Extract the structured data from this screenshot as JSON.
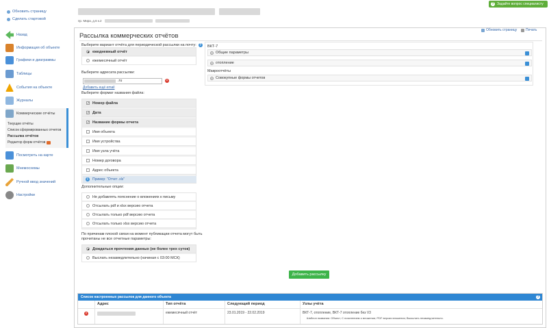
{
  "top": {
    "refresh_page": "Обновить страницу",
    "make_start": "Сделать стартовой",
    "question_btn": "Задайте вопрос специалисту",
    "address_prefix": "пр. Мира, д.6 к.2"
  },
  "sidebar": {
    "items": [
      {
        "label": "Назад",
        "icon": "back-arrow-icon",
        "color": "#5cb85c"
      },
      {
        "label": "Информация об объекте",
        "icon": "house-icon",
        "color": "#d9822b"
      },
      {
        "label": "Графики и диаграммы",
        "icon": "chart-icon",
        "color": "#4a90d9"
      },
      {
        "label": "Таблицы",
        "icon": "table-icon",
        "color": "#6b9bd1"
      },
      {
        "label": "События на объекте",
        "icon": "warning-icon",
        "color": "#f0a500"
      },
      {
        "label": "Журналы",
        "icon": "journal-icon",
        "color": "#8fb7e0"
      },
      {
        "label": "Коммерческие отчёты",
        "icon": "report-icon",
        "color": "#7fa6c9"
      }
    ],
    "sub_items": [
      {
        "label": "Текущие отчёты"
      },
      {
        "label": "Список сформированных отчетов"
      },
      {
        "label": "Рассылка отчётов"
      },
      {
        "label": "Редактор форм отчётов"
      }
    ],
    "items2": [
      {
        "label": "Посмотреть на карте",
        "icon": "map-icon",
        "color": "#4a90d9"
      },
      {
        "label": "Мнемосхемы",
        "icon": "mnemonic-icon",
        "color": "#6aa84f"
      },
      {
        "label": "Ручной ввод значений",
        "icon": "pencil-icon",
        "color": "#e8a33a"
      },
      {
        "label": "Настройки",
        "icon": "gear-icon",
        "color": "#888888"
      }
    ]
  },
  "main": {
    "title": "Рассылка коммерческих отчётов",
    "refresh_link": "Обновить страницу",
    "print_link": "Печать",
    "report_variant_label": "Выберите вариант отчёта для периодической рассылки на почту:",
    "variants": [
      {
        "label": "ежедневный отчёт",
        "selected": true
      },
      {
        "label": "ежемесячный отчёт",
        "selected": false
      }
    ],
    "address_label": "Выберите адресата рассылки:",
    "email_value": ".ru",
    "add_email": "Добавить ещё email",
    "file_name_label": "Выберите формат названия файла:",
    "file_options": [
      {
        "label": "Номер файла",
        "checked": true
      },
      {
        "label": "Дата",
        "checked": true
      },
      {
        "label": "Название формы отчета",
        "checked": true
      },
      {
        "label": "Имя объекта",
        "checked": false
      },
      {
        "label": "Имя устройства",
        "checked": false
      },
      {
        "label": "Имя узла учёта",
        "checked": false
      },
      {
        "label": "Номер договора",
        "checked": false
      },
      {
        "label": "Адрес объекта",
        "checked": false
      }
    ],
    "example": "Пример: \"Отчет .xls\"",
    "extra_label": "Дополнительные опции:",
    "extra_options": [
      {
        "label": "Не добавлять пояснение о вложениях к письму"
      },
      {
        "label": "Отсылать pdf и xlsx версию отчета"
      },
      {
        "label": "Отсылать только pdf версию отчета"
      },
      {
        "label": "Отсылать только xlsx версию отчета"
      }
    ],
    "bad_conn_label_1": "По причинам плохой связи на момент публикации отчета могут быть",
    "bad_conn_label_2": "прочитаны не все отчетные параметры:",
    "wait_options": [
      {
        "label": "Дождаться прочтения данных (не более трех суток)",
        "selected": true
      },
      {
        "label": "Выслать незамедлительно (начиная с 03:00 МСК)",
        "selected": false
      }
    ],
    "right": {
      "device_head": "ВКТ-7",
      "device_rows": [
        "Общие параметры",
        "отопление"
      ],
      "macro_head": "Макроотчёты",
      "macro_rows": [
        "Совокупные формы отчетов"
      ]
    },
    "add_button": "Добавить рассылку",
    "list": {
      "title": "Список настроенных рассылок для данного объекта",
      "columns": [
        "Адрес",
        "Тип отчёта",
        "Следующий период",
        "Узлы учёта"
      ],
      "row": {
        "type": "ежемесячный отчёт",
        "period": "23.01.2019 - 22.02.2019",
        "nodes": "ВКТ-7, отопление, ВКТ-7 отопление без V3",
        "note": "Шаблон названия: Объект; С пояснением о вложении; PDF версия вложения; Высылать незамедлительно."
      }
    }
  }
}
